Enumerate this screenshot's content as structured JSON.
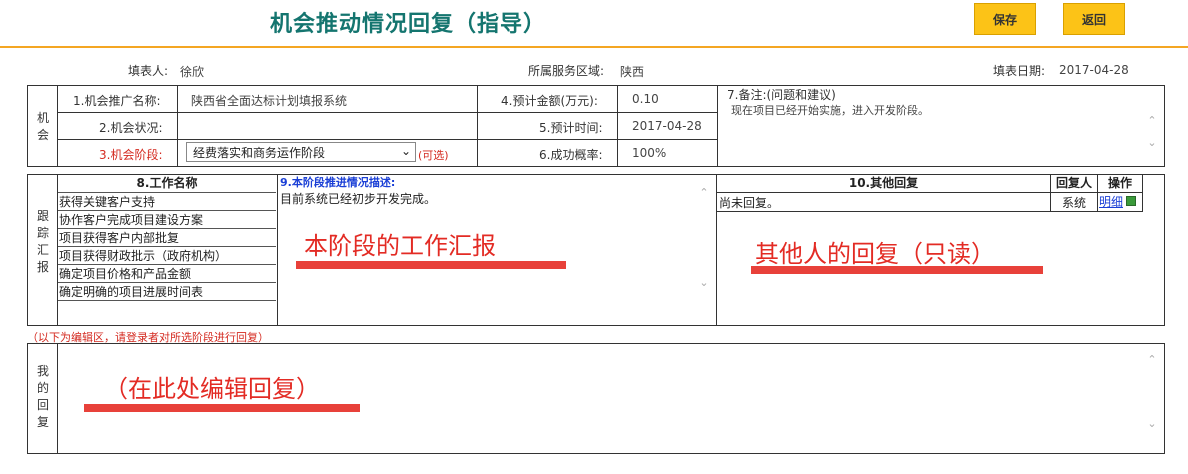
{
  "header": {
    "title": "机会推动情况回复（指导）",
    "save_label": "保存",
    "back_label": "返回"
  },
  "info": {
    "filler_label": "填表人:",
    "filler_value": "徐欣",
    "region_label": "所属服务区域:",
    "region_value": "陕西",
    "date_label": "填表日期:",
    "date_value": "2017-04-28"
  },
  "opportunity": {
    "section_label": [
      "机",
      "会"
    ],
    "name_label": "1.机会推广名称:",
    "name_value": "陕西省全面达标计划填报系统",
    "status_label": "2.机会状况:",
    "status_value": "",
    "stage_label": "3.机会阶段:",
    "stage_value": "经费落实和商务运作阶段",
    "stage_optional": "(可选)",
    "amount_label": "4.预计金额(万元):",
    "amount_value": "0.10",
    "time_label": "5.预计时间:",
    "time_value": "2017-04-28",
    "prob_label": "6.成功概率:",
    "prob_value": "100%",
    "remark_label": "7.备注:(问题和建议)",
    "remark_value": "现在项目已经开始实施，进入开发阶段。"
  },
  "tracking": {
    "section_label": [
      "跟",
      "踪",
      "汇",
      "报"
    ],
    "work_header": "8.工作名称",
    "work_items": [
      "获得关键客户支持",
      "协作客户完成项目建设方案",
      "项目获得客户内部批复",
      "项目获得财政批示（政府机构）",
      "确定项目价格和产品金额",
      "确定明确的项目进展时间表"
    ],
    "progress_header": "9.本阶段推进情况描述:",
    "progress_text": "目前系统已经初步开发完成。",
    "progress_annotation": "本阶段的工作汇报",
    "other_header": "10.其他回复",
    "replier_header": "回复人",
    "op_header": "操作",
    "other_text": "尚未回复。",
    "replier_value": "系统",
    "detail_link": "明细",
    "other_annotation": "其他人的回复（只读）"
  },
  "edit": {
    "note": "（以下为编辑区，请登录者对所选阶段进行回复）",
    "section_label": [
      "我",
      "的",
      "回",
      "复"
    ],
    "annotation": "（在此处编辑回复）"
  },
  "colors": {
    "title": "#14756f",
    "button": "#fcc317",
    "accent_line": "#f4a623",
    "annotation": "#e32b24",
    "link": "#1a3fd6"
  }
}
